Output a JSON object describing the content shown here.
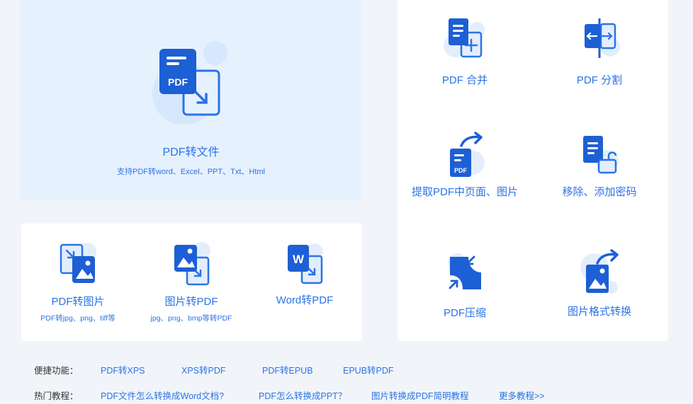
{
  "colors": {
    "accent": "#2b73e6",
    "hero_bg": "#e6f1fe",
    "page_bg": "#f1f5f9",
    "icon_dark": "#1d5fd4",
    "icon_light": "#dbeafe"
  },
  "hero": {
    "title": "PDF转文件",
    "subtitle": "支持PDF转word、Excel、PPT、Txt、Html",
    "icon": "pdf-to-file-icon",
    "icon_text": "PDF"
  },
  "small_tools": [
    {
      "label": "PDF转图片",
      "sub": "PDF转jpg、png、tiff等",
      "icon": "pdf-to-image-icon"
    },
    {
      "label": "图片转PDF",
      "sub": "jpg、png、bmp等转PDF",
      "icon": "image-to-pdf-icon"
    },
    {
      "label": "Word转PDF",
      "sub": "",
      "icon": "word-to-pdf-icon",
      "icon_text": "W"
    }
  ],
  "right_tools": [
    {
      "label": "PDF 合并",
      "icon": "pdf-merge-icon"
    },
    {
      "label": "PDF 分割",
      "icon": "pdf-split-icon"
    },
    {
      "label": "提取PDF中页面、图片",
      "icon": "extract-pages-icon",
      "icon_text": "PDF"
    },
    {
      "label": "移除、添加密码",
      "icon": "password-lock-icon"
    },
    {
      "label": "PDF压缩",
      "icon": "pdf-compress-icon"
    },
    {
      "label": "图片格式转换",
      "icon": "image-format-convert-icon"
    }
  ],
  "quick_links": {
    "label": "便捷功能：",
    "items": [
      "PDF转XPS",
      "XPS转PDF",
      "PDF转EPUB",
      "EPUB转PDF"
    ]
  },
  "tutorials": {
    "label": "热门教程：",
    "items": [
      "PDF文件怎么转换成Word文档?",
      "PDF怎么转换成PPT？",
      "图片转换成PDF简明教程",
      "更多教程>>"
    ]
  }
}
